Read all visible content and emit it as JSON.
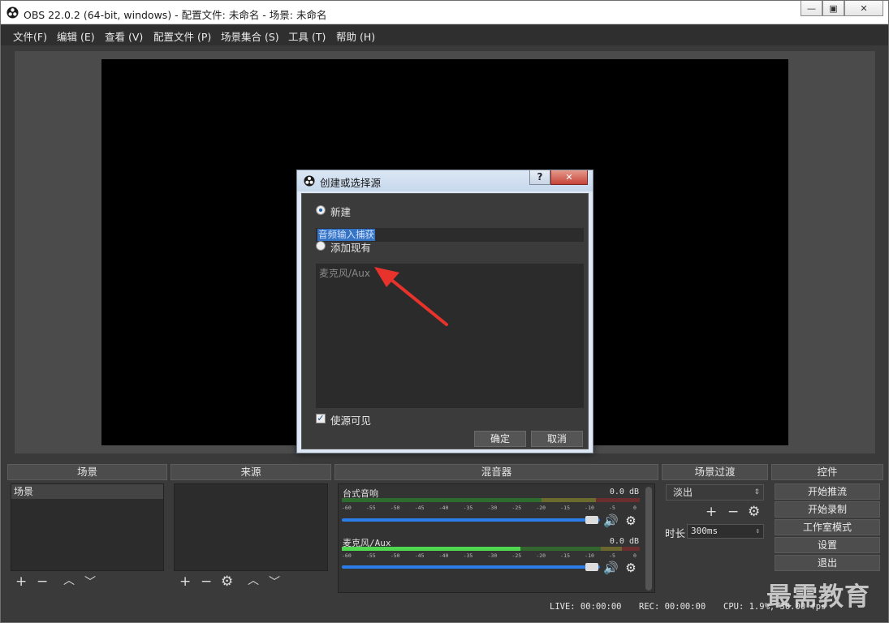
{
  "window": {
    "title": "OBS 22.0.2 (64-bit, windows) - 配置文件: 未命名 - 场景: 未命名",
    "min_glyph": "—",
    "max_glyph": "▣",
    "close_glyph": "✕"
  },
  "menu": [
    "文件(F)",
    "编辑 (E)",
    "查看 (V)",
    "配置文件 (P)",
    "场景集合 (S)",
    "工具 (T)",
    "帮助 (H)"
  ],
  "docks": {
    "scenes": {
      "title": "场景",
      "items": [
        "场景"
      ]
    },
    "sources": {
      "title": "来源"
    },
    "mixer": {
      "title": "混音器",
      "ticks": [
        "-60",
        "-55",
        "-50",
        "-45",
        "-40",
        "-35",
        "-30",
        "-25",
        "-20",
        "-15",
        "-10",
        "-5",
        "0"
      ],
      "tracks": [
        {
          "name": "台式音响",
          "db": "0.0 dB",
          "level": 0
        },
        {
          "name": "麦克风/Aux",
          "db": "0.0 dB",
          "level": 0.6
        }
      ]
    },
    "transitions": {
      "title": "场景过渡",
      "selected": "淡出",
      "duration_label": "时长",
      "duration": "300ms"
    },
    "controls": {
      "title": "控件",
      "buttons": [
        "开始推流",
        "开始录制",
        "工作室模式",
        "设置",
        "退出"
      ]
    }
  },
  "status": {
    "live": "LIVE: 00:00:00",
    "rec": "REC: 00:00:00",
    "cpu": "CPU: 1.9%, 30.00 fps"
  },
  "watermark": "最需教育",
  "dialog": {
    "title": "创建或选择源",
    "help_glyph": "?",
    "close_glyph": "✕",
    "new_label": "新建",
    "new_selected": true,
    "name_value": "音频输入捕获",
    "existing_label": "添加现有",
    "existing_items": [
      "麦克风/Aux"
    ],
    "visible_label": "使源可见",
    "visible_checked": true,
    "ok": "确定",
    "cancel": "取消"
  },
  "colors": {
    "accent": "#2b7de9",
    "arrow": "#e8322c",
    "meter_green": "#3fb83f",
    "meter_yellow": "#b8b83f",
    "meter_red": "#b83f3f"
  }
}
